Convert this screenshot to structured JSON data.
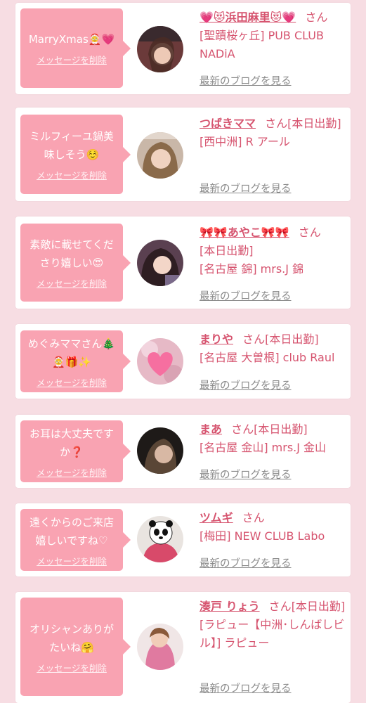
{
  "messages": [
    {
      "text": "MarryXmas🤶💗",
      "delete_label": "メッセージを削除",
      "name": "💗😻浜田麻里😻💗",
      "suffix": "さん",
      "status": "",
      "shop": "[聖蹟桜ヶ丘] PUB CLUB NADiA",
      "blog_label": "最新のブログを見る",
      "avatar_icon": "avatar-photo"
    },
    {
      "text": "ミルフィーユ鍋美味しそう☺️",
      "delete_label": "メッセージを削除",
      "name": "つばきママ",
      "suffix": "さん",
      "status": "[本日出勤]",
      "shop": "[西中洲] R アール",
      "blog_label": "最新のブログを見る",
      "avatar_icon": "avatar-photo"
    },
    {
      "text": "素敵に載せてくださり嬉しい😍",
      "delete_label": "メッセージを削除",
      "name": "🎀🎀あやこ🎀🎀",
      "suffix": "さん",
      "status": "[本日出勤]",
      "shop": "[名古屋 錦] mrs.J 錦",
      "blog_label": "最新のブログを見る",
      "avatar_icon": "avatar-photo"
    },
    {
      "text": "めぐみママさん🎄🤶🎁✨",
      "delete_label": "メッセージを削除",
      "name": "まりや",
      "suffix": "さん",
      "status": "[本日出勤]",
      "shop": "[名古屋 大曽根] club Raul",
      "blog_label": "最新のブログを見る",
      "avatar_icon": "heart-avatar"
    },
    {
      "text": "お耳は大丈夫ですか❓",
      "delete_label": "メッセージを削除",
      "name": "まあ",
      "suffix": "さん",
      "status": "[本日出勤]",
      "shop": "[名古屋 金山] mrs.J 金山",
      "blog_label": "最新のブログを見る",
      "avatar_icon": "avatar-photo"
    },
    {
      "text": "遠くからのご来店嬉しいですね♡",
      "delete_label": "メッセージを削除",
      "name": "ツムギ",
      "suffix": "さん",
      "status": "",
      "shop": "[梅田] NEW CLUB Labo",
      "blog_label": "最新のブログを見る",
      "avatar_icon": "panda-avatar"
    },
    {
      "text": "オリシャンありがたいね🤗",
      "delete_label": "メッセージを削除",
      "name": "湊戸 りょう",
      "suffix": "さん",
      "status": "[本日出勤]",
      "shop": "[ラピュー【中洲･しんばしビル】] ラピュー",
      "blog_label": "最新のブログを見る",
      "avatar_icon": "avatar-photo"
    }
  ],
  "colors": {
    "background": "#f7dde3",
    "bubble": "#f9a3b2",
    "accent": "#d6546f",
    "link_gray": "#8a8a8a"
  }
}
